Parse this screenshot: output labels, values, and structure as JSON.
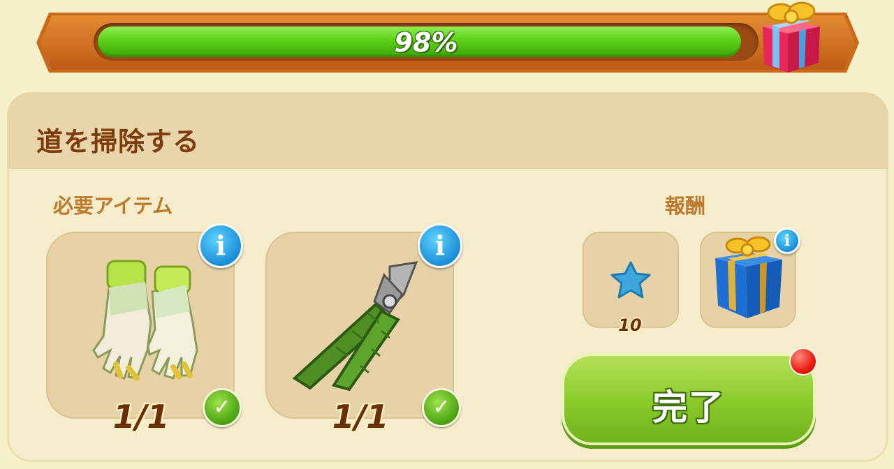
{
  "progress": {
    "value_percent": 98,
    "label": "98%"
  },
  "task": {
    "title": "道を掃除する",
    "required_label": "必要アイテム",
    "reward_label": "報酬"
  },
  "required_items": [
    {
      "name": "gloves-icon",
      "count": "1/1",
      "complete": true
    },
    {
      "name": "pruning-shears-icon",
      "count": "1/1",
      "complete": true
    }
  ],
  "rewards": [
    {
      "name": "blue-star-icon",
      "amount": "10"
    },
    {
      "name": "blue-gift-box-icon",
      "amount": ""
    }
  ],
  "actions": {
    "complete_label": "完了"
  },
  "icons": {
    "info": "i",
    "check": "✓"
  },
  "colors": {
    "accent_green": "#8ccb2c",
    "title_brown": "#7c3c0d",
    "label_orange": "#bd7a2c",
    "notification_red": "#e81c12"
  }
}
